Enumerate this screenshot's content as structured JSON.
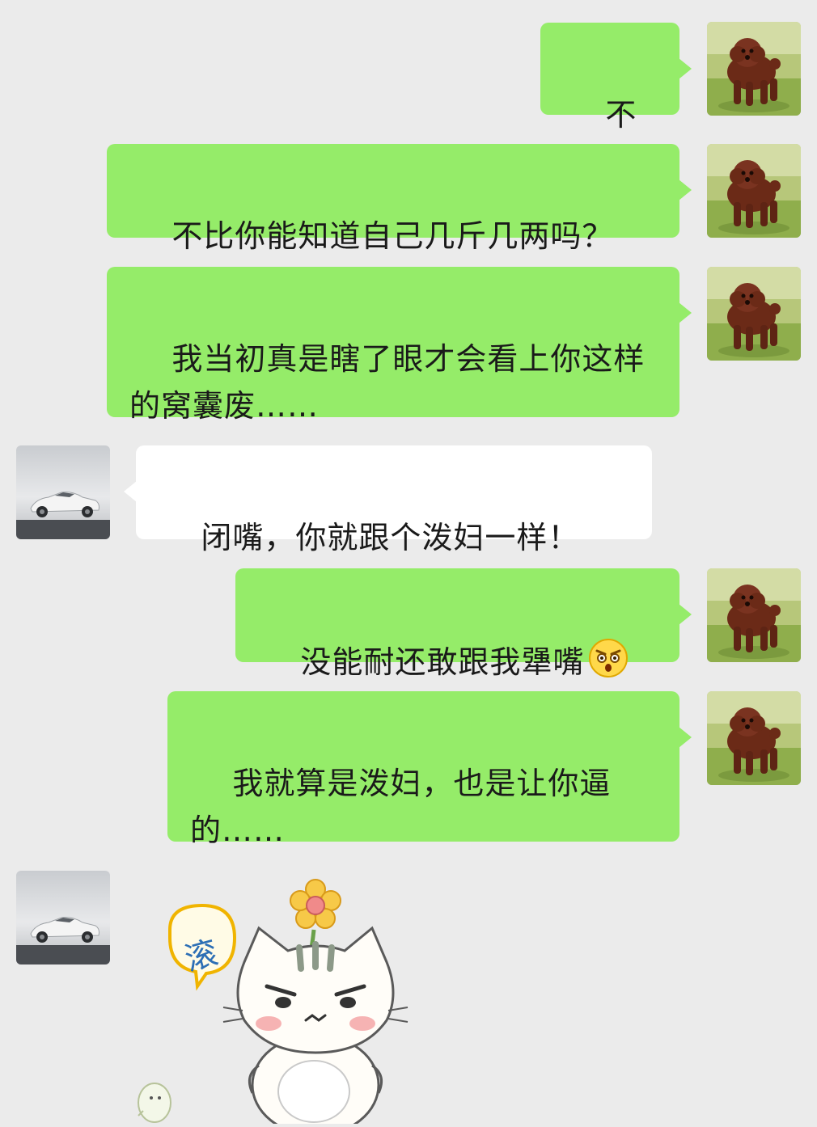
{
  "messages": [
    {
      "side": "me",
      "text": "不比？"
    },
    {
      "side": "me",
      "text": "不比你能知道自己几斤几两吗？"
    },
    {
      "side": "me",
      "text": "我当初真是瞎了眼才会看上你这样的窝囊废……"
    },
    {
      "side": "them",
      "text": "闭嘴，你就跟个泼妇一样！"
    },
    {
      "side": "me",
      "text": "没能耐还敢跟我犟嘴",
      "emoji": "angry-face-emoji"
    },
    {
      "side": "me",
      "text": "我就算是泼妇，也是让你逼的……"
    }
  ],
  "sticker": {
    "text": "滚",
    "icon": "angry-cat-sticker"
  },
  "avatars": {
    "me": "poodle-avatar-icon",
    "them": "white-car-avatar-icon"
  },
  "colors": {
    "background": "#ebebeb",
    "my_bubble": "#95ec69",
    "their_bubble": "#ffffff"
  }
}
